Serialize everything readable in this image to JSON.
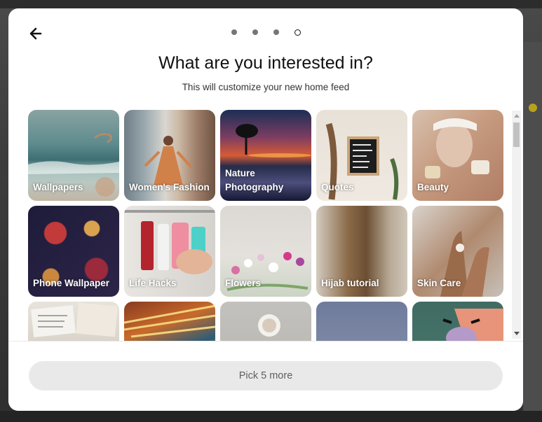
{
  "header": {
    "title": "What are you interested in?",
    "subtitle": "This will customize your new home feed",
    "steps_total": 4,
    "steps_current": 4
  },
  "topics": [
    {
      "label": "Wallpapers",
      "icon": "ocean-waves-image"
    },
    {
      "label": "Women's Fashion",
      "icon": "fashion-photo-image"
    },
    {
      "label": "Nature Photography",
      "icon": "sunset-tree-image"
    },
    {
      "label": "Quotes",
      "icon": "letter-board-image"
    },
    {
      "label": "Beauty",
      "icon": "face-mask-image"
    },
    {
      "label": "Phone Wallpaper",
      "icon": "floral-pattern-image"
    },
    {
      "label": "Life Hacks",
      "icon": "hanging-products-image"
    },
    {
      "label": "Flowers",
      "icon": "flowers-image"
    },
    {
      "label": "Hijab tutorial",
      "icon": "hijab-image"
    },
    {
      "label": "Skin Care",
      "icon": "hand-cream-image"
    },
    {
      "label": "",
      "icon": "papers-image"
    },
    {
      "label": "",
      "icon": "paint-brushes-image"
    },
    {
      "label": "",
      "icon": "coffee-cup-image"
    },
    {
      "label": "",
      "icon": "blue-sky-image"
    },
    {
      "label": "",
      "icon": "cartoon-image"
    }
  ],
  "footer": {
    "button_label": "Pick 5 more"
  },
  "colors": {
    "accent_button_bg": "#e9e9e9",
    "button_text": "#5f5f5f",
    "title_text": "#111111"
  }
}
